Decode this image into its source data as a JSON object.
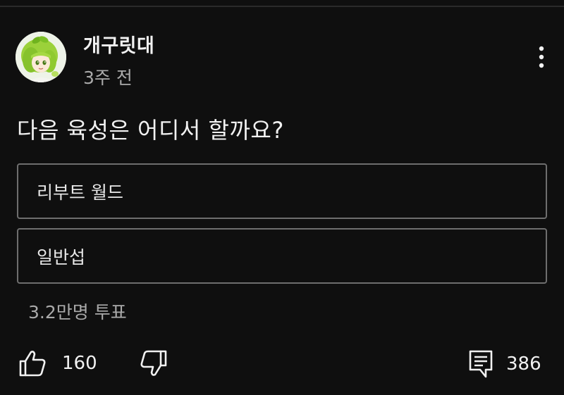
{
  "post": {
    "author": "개구릿대",
    "time": "3주 전",
    "question": "다음 육성은 어디서 할까요?"
  },
  "poll": {
    "options": [
      {
        "label": "리부트 월드"
      },
      {
        "label": "일반섭"
      }
    ],
    "votes": "3.2만명 투표"
  },
  "actions": {
    "like_count": "160",
    "comment_count": "386"
  },
  "icons": {
    "more": "more-vertical-icon",
    "like": "thumbs-up-icon",
    "dislike": "thumbs-down-icon",
    "comment": "comment-icon"
  },
  "colors": {
    "background": "#0f0f0f",
    "text": "#f1f1f1",
    "muted": "#aaaaaa",
    "border": "#6e6e6e"
  }
}
